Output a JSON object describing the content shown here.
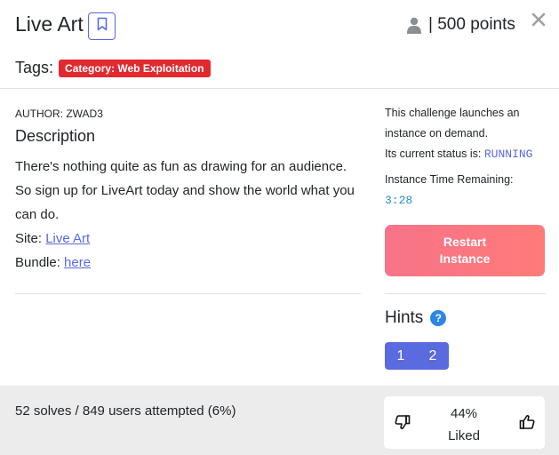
{
  "header": {
    "title": "Live Art",
    "points": "| 500 points",
    "icons": {
      "bookmark": "bookmark-icon",
      "user": "user-icon",
      "close": "close-icon"
    }
  },
  "tags": {
    "label": "Tags:",
    "items": [
      "Category: Web Exploitation"
    ]
  },
  "description": {
    "author": "AUTHOR: ZWAD3",
    "title": "Description",
    "text": "There's nothing quite as fun as drawing for an audience. So sign up for LiveArt today and show the world what you can do.",
    "site_label": "Site:",
    "site_link": "Live Art",
    "bundle_label": "Bundle:",
    "bundle_link": "here"
  },
  "instance": {
    "launch_text": "This challenge launches an instance on demand.",
    "status_label": "Its current status is:",
    "status_value": "RUNNING",
    "time_label": "Instance Time Remaining:",
    "time_value": "3:28",
    "restart_line1": "Restart",
    "restart_line2": "Instance"
  },
  "hints": {
    "title": "Hints",
    "help_glyph": "?",
    "buttons": [
      "1",
      "2"
    ]
  },
  "footer": {
    "solves": "52 solves / 849 users attempted (6%)",
    "liked_percent": "44%",
    "liked_label": "Liked"
  },
  "colors": {
    "accent": "#5a6adf",
    "tag_red": "#e2292f",
    "restart_gradient_start": "#f77389",
    "restart_gradient_end": "#ff7b78",
    "help_blue": "#2c86e6",
    "footer_bg": "#ececec"
  }
}
